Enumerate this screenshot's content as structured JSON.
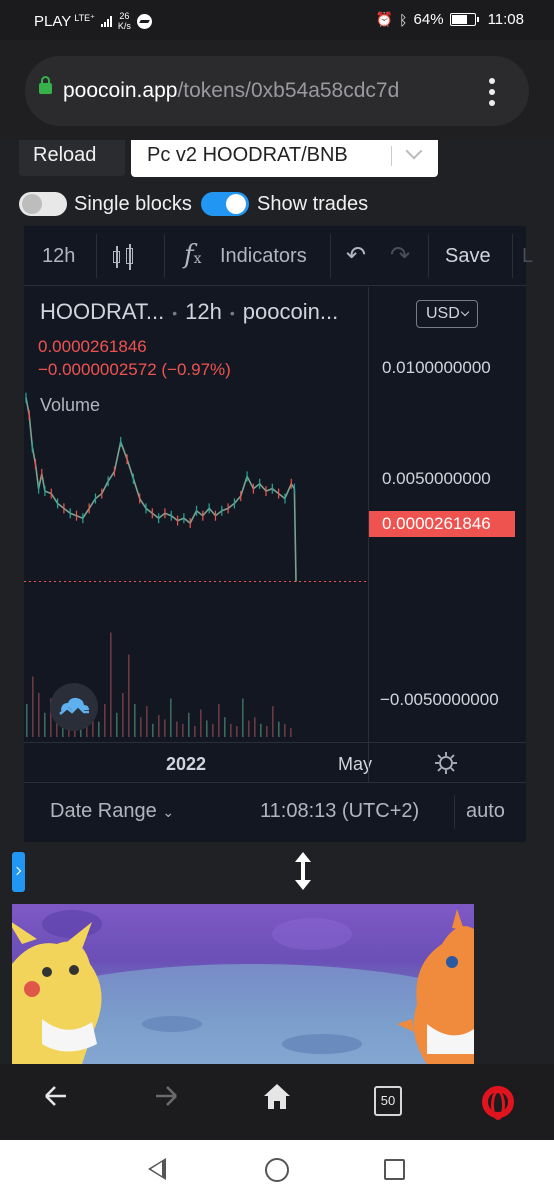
{
  "status_bar": {
    "carrier": "PLAY",
    "network": "LTE⁺",
    "speed_value": "26",
    "speed_unit": "K/s",
    "battery": "64%",
    "time": "11:08"
  },
  "browser": {
    "url_host": "poocoin.app",
    "url_path": "/tokens/0xb54a58cdc7d"
  },
  "controls": {
    "reload_label": "Reload",
    "pair_value": "Pc v2 HOODRAT/BNB",
    "single_blocks_label": "Single blocks",
    "single_blocks_on": false,
    "show_trades_label": "Show trades",
    "show_trades_on": true
  },
  "chart_toolbar": {
    "interval": "12h",
    "indicators_label": "Indicators",
    "save_label": "Save",
    "cut_label": "L"
  },
  "legend": {
    "symbol": "HOODRAT...",
    "interval": "12h",
    "source": "poocoin...",
    "last_price": "0.0000261846",
    "change": "−0.0000002572 (−0.97%)",
    "volume_label": "Volume",
    "currency": "USD"
  },
  "chart_data": {
    "type": "line",
    "y_axis_ticks": [
      "0.0100000000",
      "0.0050000000",
      "−0.0050000000"
    ],
    "last_price_tag": "0.0000261846",
    "x_axis_ticks": [
      "2022",
      "May"
    ],
    "x": [
      0,
      2,
      4,
      6,
      8,
      10,
      12,
      16,
      20,
      24,
      28,
      32,
      36,
      40,
      44,
      48,
      52,
      56,
      60,
      64,
      68,
      72,
      76,
      80,
      84,
      88,
      92,
      96,
      100,
      104,
      108,
      112,
      116,
      120,
      124,
      128,
      132,
      136,
      140,
      144,
      148,
      152,
      156,
      160,
      164,
      168,
      170,
      171
    ],
    "values": [
      0.0075,
      0.0068,
      0.0055,
      0.0048,
      0.0038,
      0.0044,
      0.0037,
      0.0036,
      0.0032,
      0.003,
      0.0028,
      0.0027,
      0.0026,
      0.003,
      0.0034,
      0.0036,
      0.0041,
      0.0045,
      0.0057,
      0.005,
      0.0042,
      0.0034,
      0.003,
      0.0028,
      0.0026,
      0.0028,
      0.0027,
      0.0025,
      0.0026,
      0.0024,
      0.0029,
      0.0027,
      0.003,
      0.0027,
      0.0029,
      0.003,
      0.0032,
      0.0035,
      0.0043,
      0.0038,
      0.004,
      0.0037,
      0.0038,
      0.0036,
      0.0034,
      0.004,
      0.0038,
      2.62e-05
    ],
    "ylim": [
      -0.0065,
      0.012
    ],
    "grid": false,
    "currency": "USD"
  },
  "volume_data": {
    "values": [
      0.3,
      0.55,
      0.4,
      0.22,
      0.35,
      0.18,
      0.25,
      0.15,
      0.12,
      0.2,
      0.1,
      0.16,
      0.14,
      0.3,
      0.95,
      0.22,
      0.4,
      0.75,
      0.3,
      0.18,
      0.28,
      0.12,
      0.2,
      0.16,
      0.35,
      0.14,
      0.12,
      0.22,
      0.1,
      0.25,
      0.15,
      0.12,
      0.3,
      0.18,
      0.12,
      0.1,
      0.35,
      0.15,
      0.18,
      0.12,
      0.1,
      0.28,
      0.14,
      0.12,
      0.08
    ]
  },
  "bottom_bar": {
    "date_range_label": "Date Range",
    "clock": "11:08:13 (UTC+2)",
    "auto_label": "auto"
  },
  "browser_nav": {
    "tab_count": "50"
  },
  "colors": {
    "accent_blue": "#2196f3",
    "down_red": "#ef5350",
    "chart_bg": "#131722"
  }
}
